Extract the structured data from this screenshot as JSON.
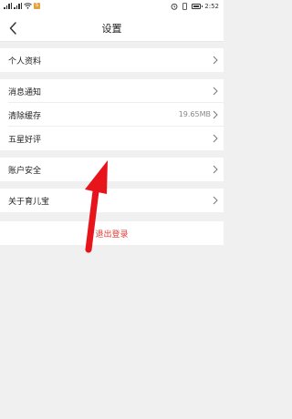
{
  "status_bar": {
    "carrier_badge": "S",
    "time": "2:52",
    "icons": [
      "signal-icon",
      "wifi-icon",
      "alarm-icon",
      "vibrate-icon",
      "battery-icon"
    ]
  },
  "header": {
    "title": "设置",
    "back_icon": "chevron-left-icon"
  },
  "settings": {
    "profile": "个人资料",
    "notifications": "消息通知",
    "clear_cache": "清除缓存",
    "cache_size": "19.65MB",
    "rate": "五星好评",
    "account_security": "账户安全",
    "about": "关于育儿宝"
  },
  "logout_label": "退出登录",
  "colors": {
    "accent": "#e53935",
    "background": "#f0f0f0",
    "annotation_arrow": "#e8141c"
  }
}
